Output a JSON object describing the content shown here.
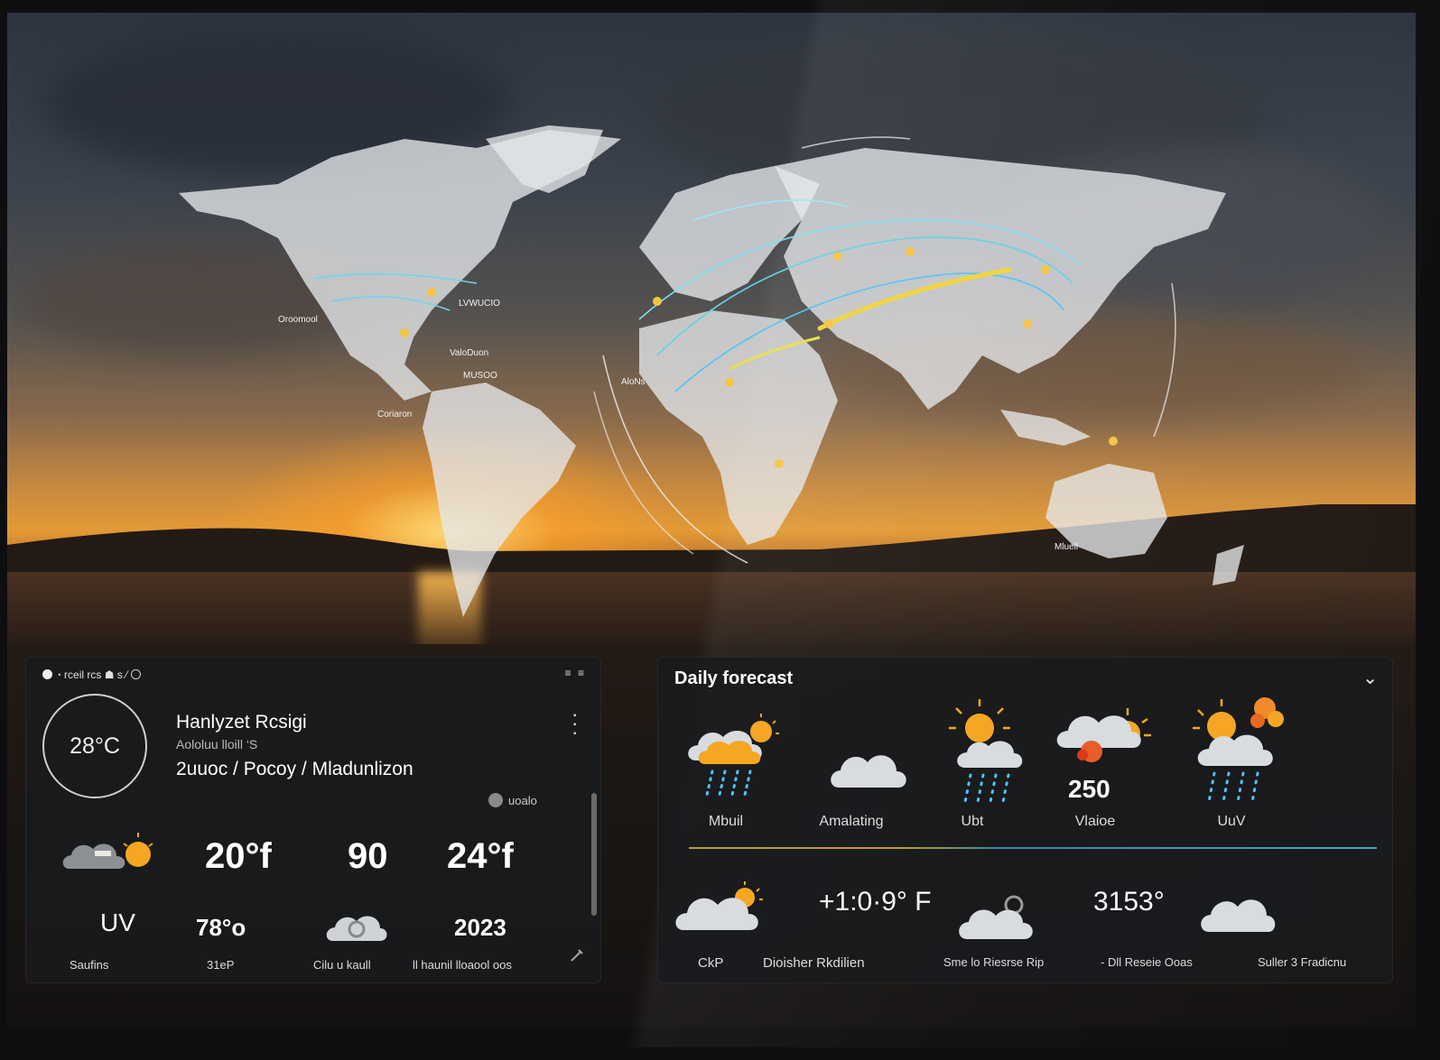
{
  "current": {
    "status_text": "ꞏ rceil rcs  ☗ s ⁄ 〇",
    "status_right": "≡ ≡",
    "temperature": "28°C",
    "location_title": "Hanlyzet Rcsigi",
    "location_sub": "Aololuu lloill ‘S",
    "conditions": "2uuoc / Pocoy / Mladunlizon",
    "toggle_label": "uoalo",
    "stats_row1": {
      "temp_low": "20°f",
      "humidity": "90",
      "temp_high": "24°f"
    },
    "stats_row2": {
      "uv_label": "UV",
      "pct": "78°o",
      "year": "2023"
    },
    "footer": [
      "Saufins",
      "31eP",
      "Cilu u kaull",
      "ll  haunil lloaool oos"
    ],
    "icons": [
      "partly-sunny-cloud-icon",
      "cloud-icon",
      "settings-icon"
    ]
  },
  "forecast": {
    "title": "Daily forecast",
    "chevron": "⌄",
    "days": [
      {
        "label": "Mbuil",
        "icon": "rain-sun-cloud-icon"
      },
      {
        "label": "Amalating",
        "icon": "cloud-icon"
      },
      {
        "label": "Ubt",
        "icon": "sun-rain-cloud-icon"
      },
      {
        "label": "Vlaioe",
        "icon": "storm-sun-cloud-icon",
        "value": "250"
      },
      {
        "label": "UuV",
        "icon": "sun-rain-cloud-icon"
      }
    ],
    "bottom_values": {
      "left": "+1:0·9° F",
      "right": "3153°"
    },
    "footer": [
      "CkP",
      "Dioisher Rkdilien",
      "Sme lo Riesrse Rip",
      "- Dll Reseie Ooas",
      "Suller 3 Fradicnu"
    ],
    "colors": {
      "sun": "#f5a623",
      "rain": "#4fc3f7",
      "cloud": "#d8dce0"
    }
  },
  "map_labels": [
    "Oroomool",
    "LVWUCIO",
    "ValoDuon",
    "MUSOO",
    "Coriaron",
    "AloNs",
    "Mluell"
  ]
}
